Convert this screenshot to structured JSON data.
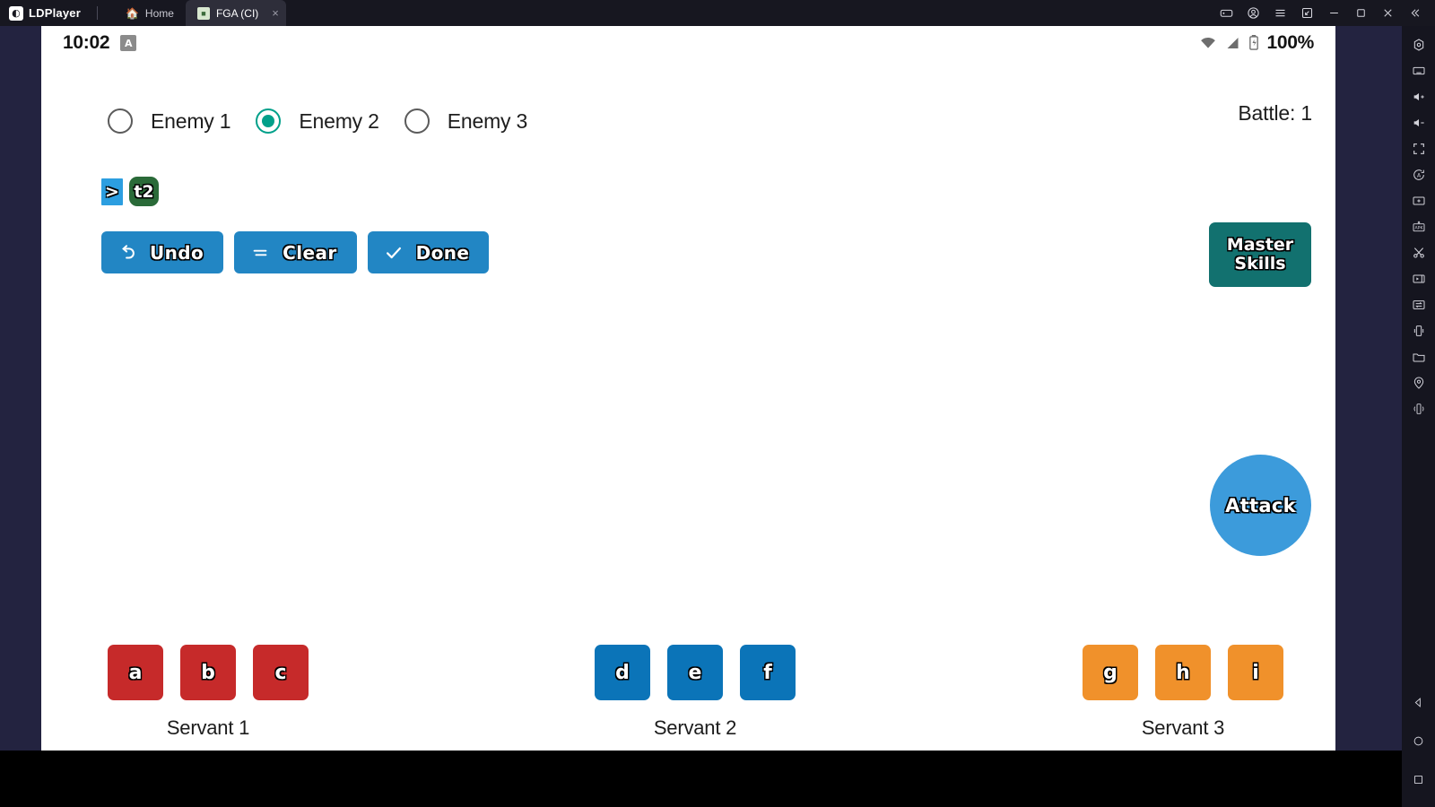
{
  "window": {
    "brand": "LDPlayer",
    "brand_mark": "◐",
    "tabs": [
      {
        "label": "Home",
        "icon": "home-icon",
        "active": false
      },
      {
        "label": "FGA (CI)",
        "icon": "app-icon",
        "active": true,
        "close": "×"
      }
    ],
    "controls": [
      {
        "name": "gamepad-icon",
        "title": "Keyboard mapping"
      },
      {
        "name": "user-icon",
        "title": "Account"
      },
      {
        "name": "menu-icon",
        "title": "Menu"
      },
      {
        "name": "multi-instance-icon",
        "title": "Multi-instance"
      },
      {
        "name": "minimize-icon",
        "title": "Minimize"
      },
      {
        "name": "maximize-icon",
        "title": "Maximize"
      },
      {
        "name": "close-icon",
        "title": "Close"
      },
      {
        "name": "collapse-icon",
        "title": "Collapse toolbar"
      }
    ]
  },
  "rightbar": {
    "items": [
      {
        "name": "settings-icon",
        "title": "Settings"
      },
      {
        "name": "keyboard-icon",
        "title": "Keyboard"
      },
      {
        "name": "volume-up-icon",
        "title": "Volume up"
      },
      {
        "name": "volume-down-icon",
        "title": "Volume down"
      },
      {
        "name": "fullscreen-icon",
        "title": "Full screen"
      },
      {
        "name": "auto-rotate-icon",
        "title": "Rotate"
      },
      {
        "name": "screenshot-icon",
        "title": "Screenshot"
      },
      {
        "name": "apk-install-icon",
        "title": "Install APK"
      },
      {
        "name": "scissors-icon",
        "title": "Cut / Clip"
      },
      {
        "name": "video-record-icon",
        "title": "Record"
      },
      {
        "name": "file-transfer-icon",
        "title": "Transfer file"
      },
      {
        "name": "shake-icon",
        "title": "Shake"
      },
      {
        "name": "folder-icon",
        "title": "Shared folder"
      },
      {
        "name": "location-icon",
        "title": "Virtual location"
      },
      {
        "name": "vibrate-icon",
        "title": "Vibrate"
      }
    ],
    "nav": [
      {
        "name": "back-icon",
        "title": "Back"
      },
      {
        "name": "home-nav-icon",
        "title": "Home"
      },
      {
        "name": "recents-icon",
        "title": "Recent apps"
      }
    ]
  },
  "statusbar": {
    "time": "10:02",
    "notification_badge": "A",
    "battery": "100%",
    "icons": [
      "wifi-icon",
      "signal-icon",
      "battery-charging-icon"
    ]
  },
  "enemy_selector": {
    "options": [
      {
        "label": "Enemy 1",
        "selected": false
      },
      {
        "label": "Enemy 2",
        "selected": true
      },
      {
        "label": "Enemy 3",
        "selected": false
      }
    ],
    "accent_color": "#00a08a"
  },
  "battle": {
    "label": "Battle: 1"
  },
  "command_chips": [
    {
      "text": ">",
      "kind": "target-arrow",
      "color": "#2c9ee0"
    },
    {
      "text": "t2",
      "kind": "skill-target",
      "color": "#2a6a38"
    }
  ],
  "actions": [
    {
      "label": "Undo",
      "icon": "undo-icon",
      "color": "#2286c4"
    },
    {
      "label": "Clear",
      "icon": "lines-icon",
      "color": "#2286c4"
    },
    {
      "label": "Done",
      "icon": "check-icon",
      "color": "#2286c4"
    }
  ],
  "master_skills": {
    "line1": "Master",
    "line2": "Skills",
    "color": "#12716f"
  },
  "attack": {
    "label": "Attack",
    "color": "#3c9bdb"
  },
  "servants": [
    {
      "name": "Servant 1",
      "color": "#c62a2a",
      "skills": [
        "a",
        "b",
        "c"
      ]
    },
    {
      "name": "Servant 2",
      "color": "#0b74b8",
      "skills": [
        "d",
        "e",
        "f"
      ]
    },
    {
      "name": "Servant 3",
      "color": "#f0912b",
      "skills": [
        "g",
        "h",
        "i"
      ]
    }
  ]
}
